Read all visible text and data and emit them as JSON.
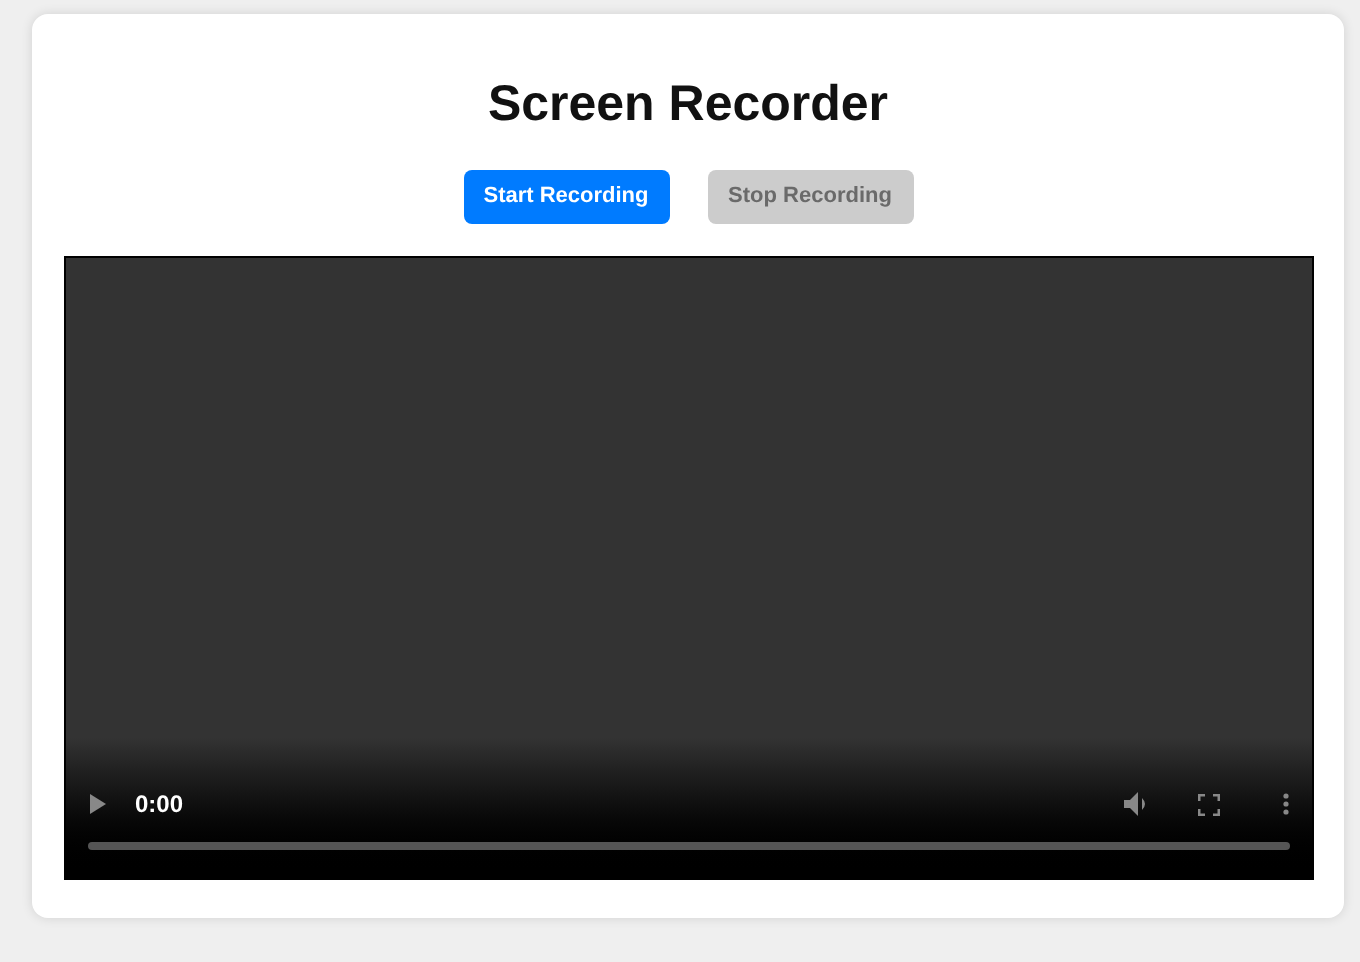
{
  "title": "Screen Recorder",
  "buttons": [
    {
      "label": "Start Recording",
      "disabled": false
    },
    {
      "label": "Stop Recording",
      "disabled": true
    }
  ],
  "video": {
    "time": "0:00"
  }
}
